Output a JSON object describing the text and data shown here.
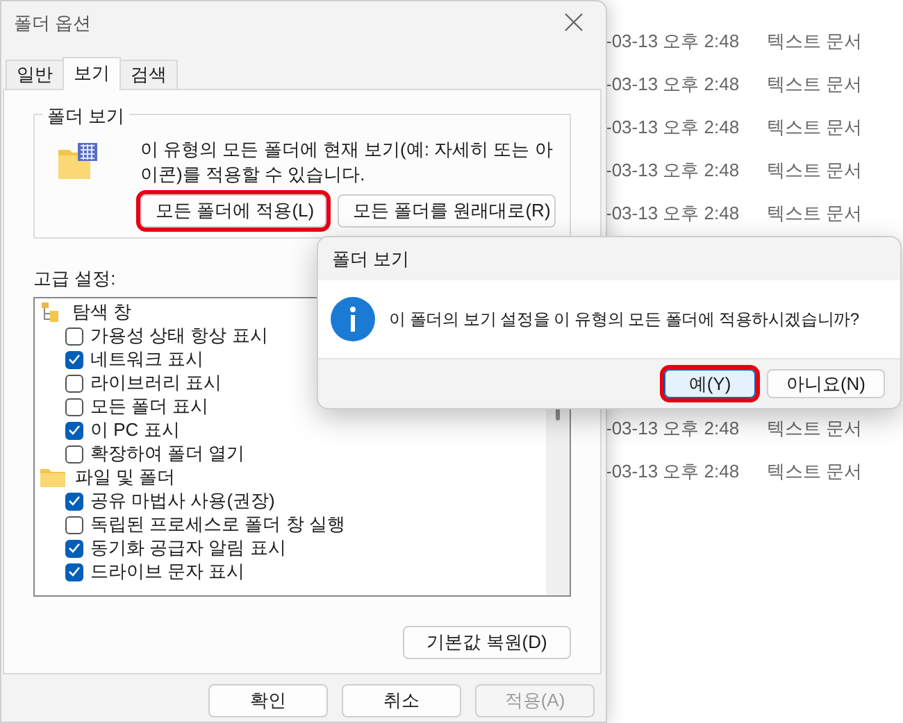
{
  "file_list": {
    "rows_top": [
      {
        "modified": "-03-13 오후 2:48",
        "type": "텍스트 문서"
      },
      {
        "modified": "-03-13 오후 2:48",
        "type": "텍스트 문서"
      },
      {
        "modified": "-03-13 오후 2:48",
        "type": "텍스트 문서"
      },
      {
        "modified": "-03-13 오후 2:48",
        "type": "텍스트 문서"
      },
      {
        "modified": "-03-13 오후 2:48",
        "type": "텍스트 문서"
      }
    ],
    "rows_bottom": [
      {
        "modified": "-03-13 오후 2:48",
        "type": "텍스트 문서"
      },
      {
        "modified": "-03-13 오후 2:48",
        "type": "텍스트 문서"
      }
    ]
  },
  "folder_options": {
    "title": "폴더 옵션",
    "tabs": [
      {
        "label": "일반",
        "selected": false
      },
      {
        "label": "보기",
        "selected": true
      },
      {
        "label": "검색",
        "selected": false
      }
    ],
    "folder_views": {
      "title": "폴더 보기",
      "description": "이 유형의 모든 폴더에 현재 보기(예: 자세히 또는 아이콘)를 적용할 수 있습니다.",
      "buttons": [
        {
          "label": "모든 폴더에 적용(L)",
          "highlighted": true
        },
        {
          "label": "모든 폴더를 원래대로(R)",
          "highlighted": false
        }
      ]
    },
    "advanced_label": "고급 설정:",
    "settings": [
      {
        "label": "탐색 창",
        "kind": "tree",
        "children": [
          {
            "label": "가용성 상태 항상 표시",
            "checked": false
          },
          {
            "label": "네트워크 표시",
            "checked": true
          },
          {
            "label": "라이브러리 표시",
            "checked": false
          },
          {
            "label": "모든 폴더 표시",
            "checked": false
          },
          {
            "label": "이 PC 표시",
            "checked": true
          },
          {
            "label": "확장하여 폴더 열기",
            "checked": false
          }
        ]
      },
      {
        "label": "파일 및 폴더",
        "kind": "folder",
        "children": [
          {
            "label": "공유 마법사 사용(권장)",
            "checked": true
          },
          {
            "label": "독립된 프로세스로 폴더 창 실행",
            "checked": false
          },
          {
            "label": "동기화 공급자 알림 표시",
            "checked": true
          },
          {
            "label": "드라이브 문자 표시",
            "checked": true
          }
        ]
      }
    ],
    "restore_button": "기본값 복원(D)",
    "footer_buttons": [
      {
        "label": "확인",
        "disabled": false
      },
      {
        "label": "취소",
        "disabled": false
      },
      {
        "label": "적용(A)",
        "disabled": true
      }
    ]
  },
  "message_box": {
    "title": "폴더 보기",
    "message": "이 폴더의 보기 설정을 이 유형의 모든 폴더에 적용하시겠습니까?",
    "buttons": [
      {
        "label": "예(Y)",
        "focused": true,
        "highlighted": true
      },
      {
        "label": "아니요(N)",
        "focused": false,
        "highlighted": false
      }
    ]
  }
}
